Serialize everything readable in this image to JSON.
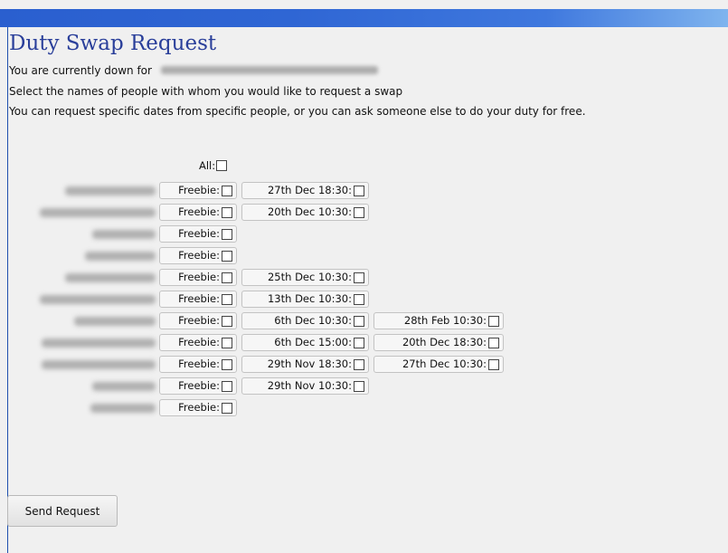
{
  "page": {
    "title": "Duty Swap Request",
    "current_duty_label": "You are currently down for",
    "instruction": "Select the names of people with whom you would like to request a swap",
    "explanation": "You can request specific dates from specific people, or you can ask someone else to do your duty for free."
  },
  "all_label": "All:",
  "freebie_label": "Freebie:",
  "rows": [
    {
      "dates": [
        "27th Dec 18:30:"
      ]
    },
    {
      "dates": [
        "20th Dec 10:30:"
      ]
    },
    {
      "dates": []
    },
    {
      "dates": []
    },
    {
      "dates": [
        "25th Dec 10:30:"
      ]
    },
    {
      "dates": [
        "13th Dec 10:30:"
      ]
    },
    {
      "dates": [
        "6th Dec 10:30:",
        "28th Feb 10:30:"
      ]
    },
    {
      "dates": [
        "6th Dec 15:00:",
        "20th Dec 18:30:"
      ]
    },
    {
      "dates": [
        "29th Nov 18:30:",
        "27th Dec 10:30:"
      ]
    },
    {
      "dates": [
        "29th Nov 10:30:"
      ]
    },
    {
      "dates": []
    }
  ],
  "send_button": "Send Request"
}
